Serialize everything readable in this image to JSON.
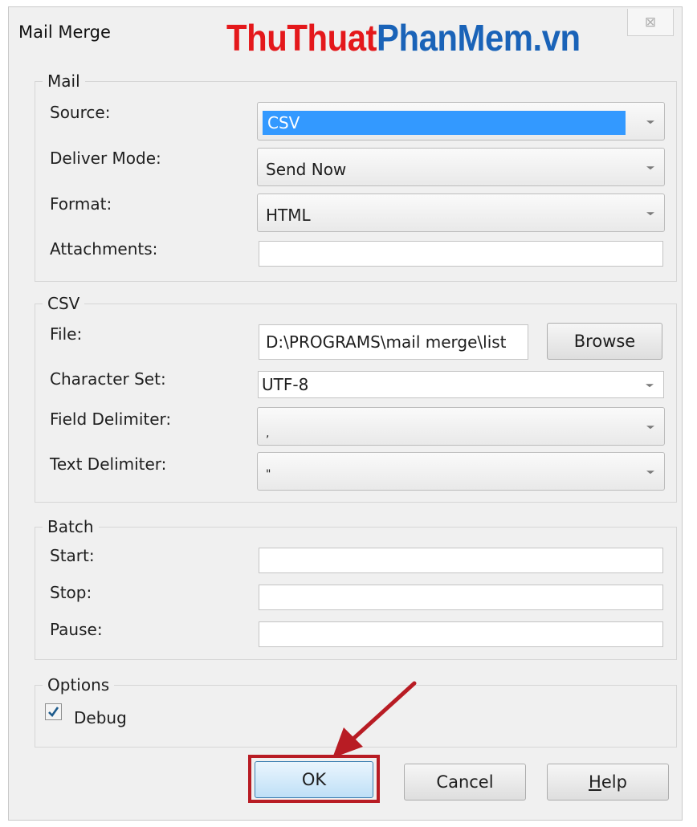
{
  "window": {
    "title": "Mail Merge",
    "close_glyph": "⊠"
  },
  "watermark": {
    "part1": "ThuThuat",
    "part2": "PhanMem.vn"
  },
  "mail": {
    "legend": "Mail",
    "source_label": "Source:",
    "source_value": "CSV",
    "deliver_label": "Deliver Mode:",
    "deliver_value": "Send Now",
    "format_label": "Format:",
    "format_value": "HTML",
    "attachments_label": "Attachments:",
    "attachments_value": ""
  },
  "csv": {
    "legend": "CSV",
    "file_label": "File:",
    "file_value": "D:\\PROGRAMS\\mail merge\\list",
    "browse_label": "Browse",
    "charset_label": "Character Set:",
    "charset_value": "UTF-8",
    "field_delim_label": "Field Delimiter:",
    "field_delim_value": ",",
    "text_delim_label": "Text Delimiter:",
    "text_delim_value": "\""
  },
  "batch": {
    "legend": "Batch",
    "start_label": "Start:",
    "start_value": "",
    "stop_label": "Stop:",
    "stop_value": "",
    "pause_label": "Pause:",
    "pause_value": ""
  },
  "options": {
    "legend": "Options",
    "debug_label": "Debug",
    "debug_checked": true
  },
  "buttons": {
    "ok": "OK",
    "cancel": "Cancel",
    "help_prefix": "H",
    "help_rest": "elp"
  },
  "colors": {
    "selection": "#3399ff",
    "annotation": "#b81c24",
    "watermark_red": "#e4181b",
    "watermark_blue": "#1a63b8"
  }
}
